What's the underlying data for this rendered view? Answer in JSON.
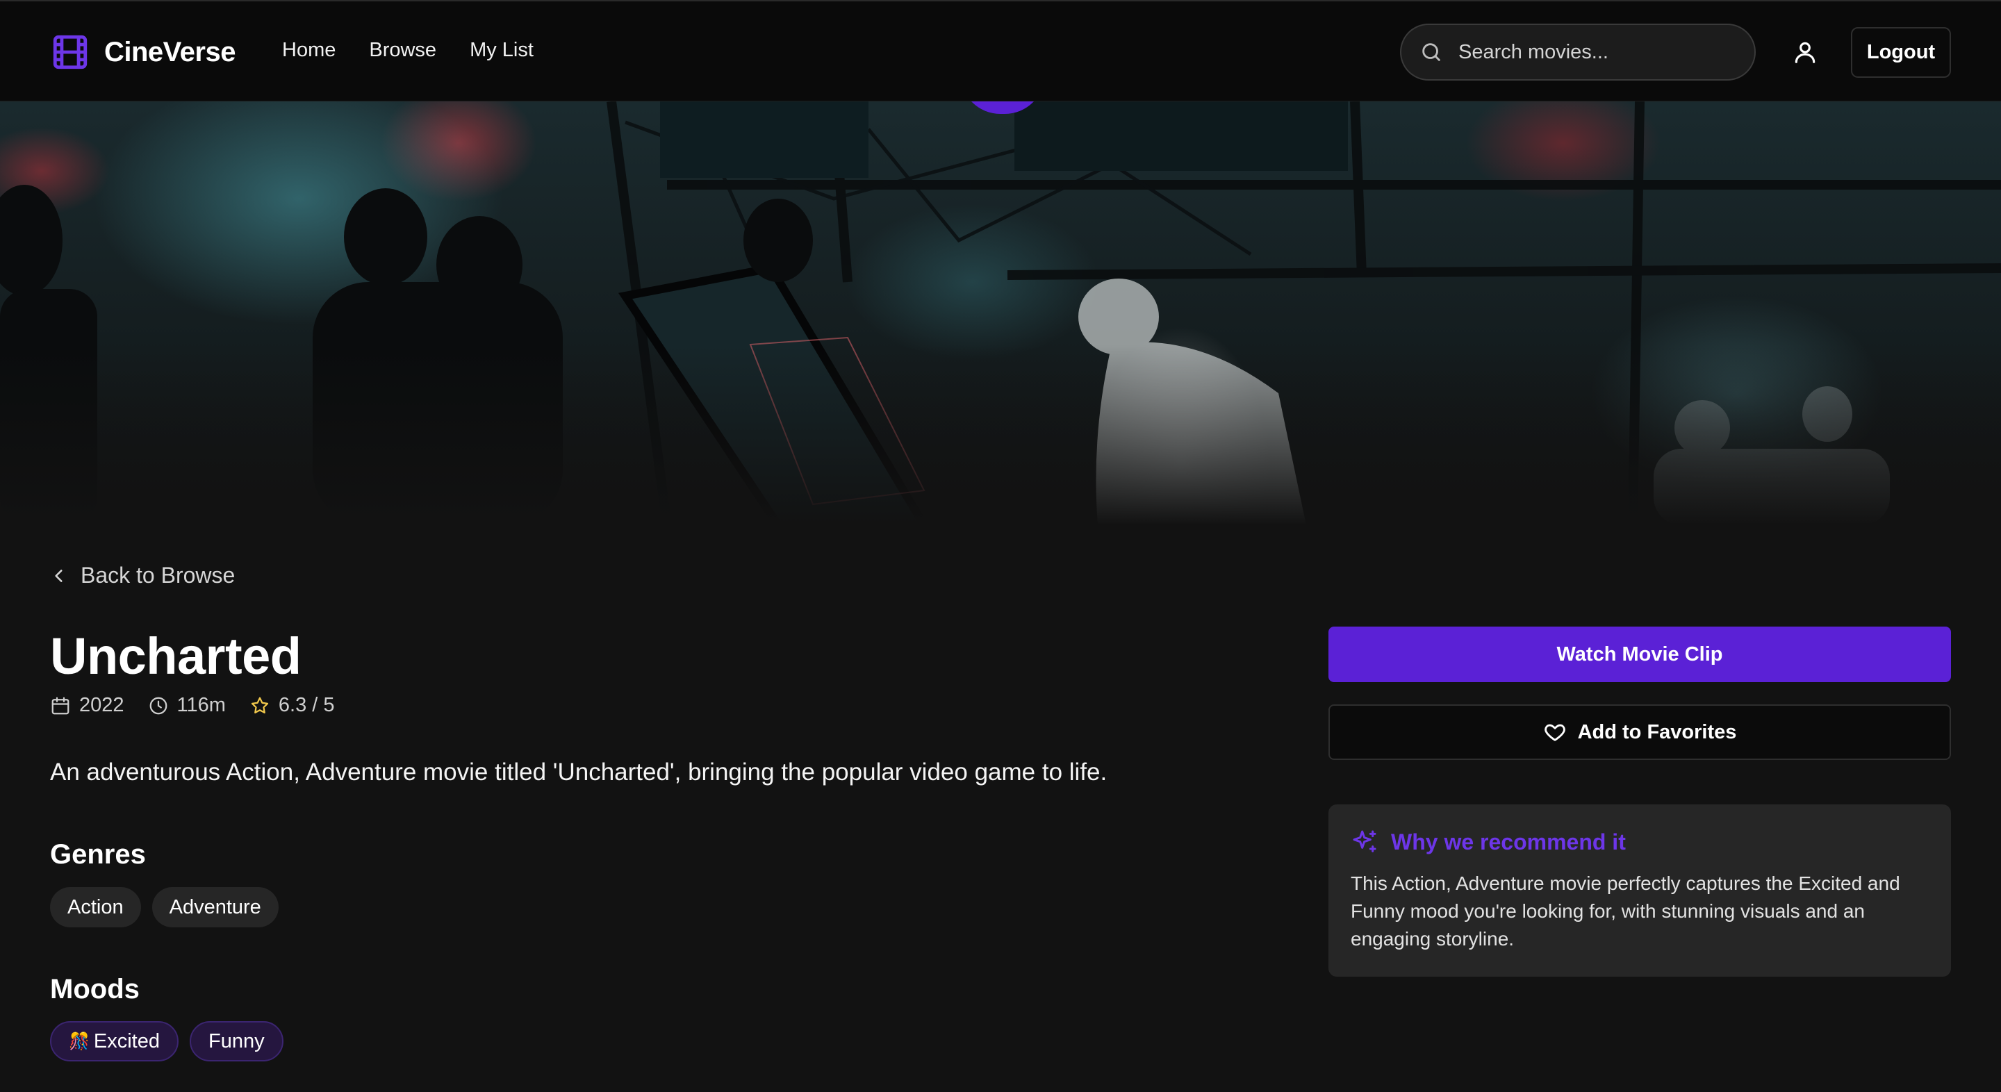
{
  "app": {
    "name": "CineVerse",
    "accent_color": "#5b21d6"
  },
  "nav": {
    "links": [
      {
        "label": "Home"
      },
      {
        "label": "Browse"
      },
      {
        "label": "My List"
      }
    ],
    "search_placeholder": "Search movies...",
    "logout_label": "Logout"
  },
  "movie": {
    "back_label": "Back to Browse",
    "title": "Uncharted",
    "year": "2022",
    "runtime": "116m",
    "rating": "6.3 / 5",
    "description": "An adventurous Action, Adventure movie titled 'Uncharted', bringing the popular video game to life.",
    "genres_heading": "Genres",
    "genres": [
      "Action",
      "Adventure"
    ],
    "moods_heading": "Moods",
    "moods": [
      {
        "emoji": "🎊",
        "label": "Excited"
      },
      {
        "emoji": "",
        "label": "Funny"
      }
    ]
  },
  "actions": {
    "watch_label": "Watch Movie Clip",
    "favorite_label": "Add to Favorites"
  },
  "recommendation": {
    "heading": "Why we recommend it",
    "text": "This Action, Adventure movie perfectly captures the Excited and Funny mood you're looking for, with stunning visuals and an engaging storyline."
  }
}
